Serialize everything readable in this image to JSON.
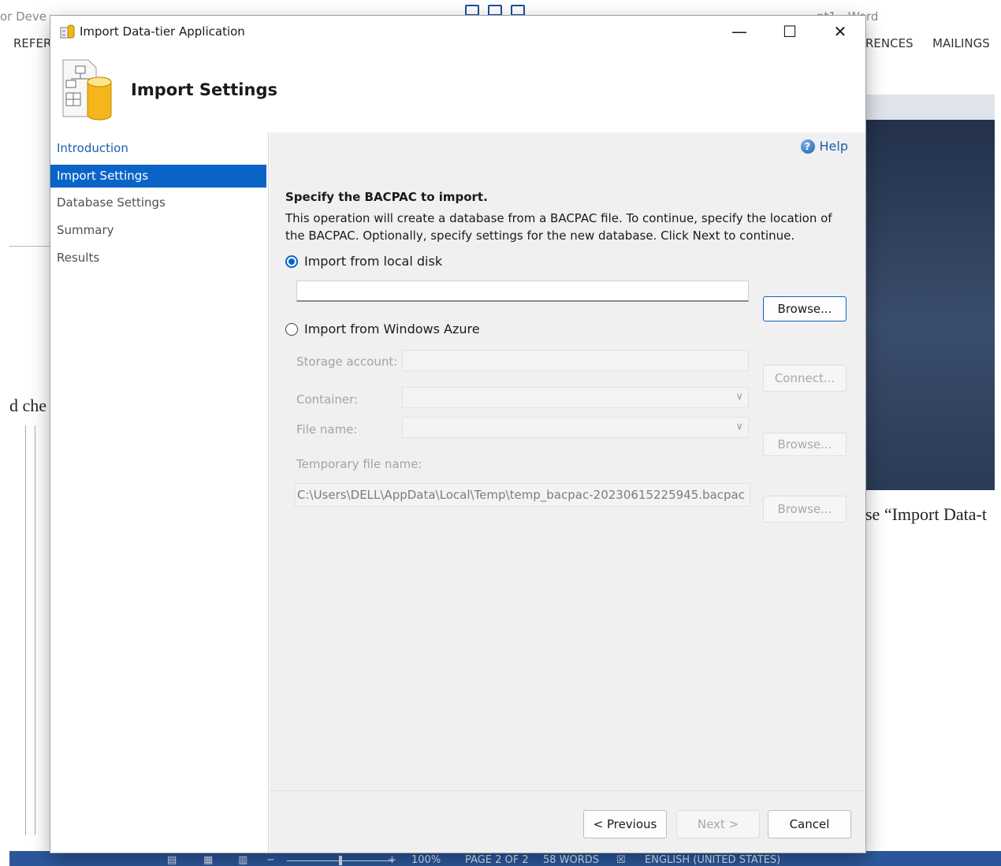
{
  "background": {
    "word_title_left": "or Deve",
    "word_title_right": "nt1 - Word",
    "ribbon_left": "REFERI",
    "ribbon_right_1": "RENCES",
    "ribbon_right_2": "MAILINGS",
    "doc_text_left": "d che",
    "doc_text_right": "se “Import Data-t",
    "status": {
      "zoom": "100%",
      "page": "PAGE 2 OF 2",
      "words": "58 WORDS",
      "language": "ENGLISH (UNITED STATES)"
    }
  },
  "dialog": {
    "title": "Import Data-tier Application",
    "header_title": "Import Settings",
    "window_controls": {
      "minimize": "—",
      "maximize": "☐",
      "close": "✕"
    },
    "nav": [
      {
        "label": "Introduction",
        "state": "link"
      },
      {
        "label": "Import Settings",
        "state": "active"
      },
      {
        "label": "Database Settings",
        "state": "normal"
      },
      {
        "label": "Summary",
        "state": "normal"
      },
      {
        "label": "Results",
        "state": "normal"
      }
    ],
    "help_label": "Help",
    "heading": "Specify the BACPAC to import.",
    "description": "This operation will create a database from a BACPAC file. To continue, specify the location of the BACPAC.  Optionally, specify settings for the new database. Click Next to continue.",
    "local_disk": {
      "label": "Import from local disk",
      "selected": true,
      "path_value": "",
      "browse_label": "Browse..."
    },
    "azure": {
      "label": "Import from Windows Azure",
      "selected": false,
      "storage_account_label": "Storage account:",
      "connect_label": "Connect...",
      "container_label": "Container:",
      "file_name_label": "File name:",
      "browse_label": "Browse...",
      "temp_file_label": "Temporary file name:",
      "temp_file_value": "C:\\Users\\DELL\\AppData\\Local\\Temp\\temp_bacpac-20230615225945.bacpac",
      "temp_browse_label": "Browse..."
    },
    "footer": {
      "previous_label": "< Previous",
      "next_label": "Next >",
      "cancel_label": "Cancel"
    }
  },
  "colors": {
    "accent": "#0a64c8",
    "link": "#1a5ea8",
    "panel_bg": "#f0f0f0",
    "statusbar": "#2b579a"
  }
}
